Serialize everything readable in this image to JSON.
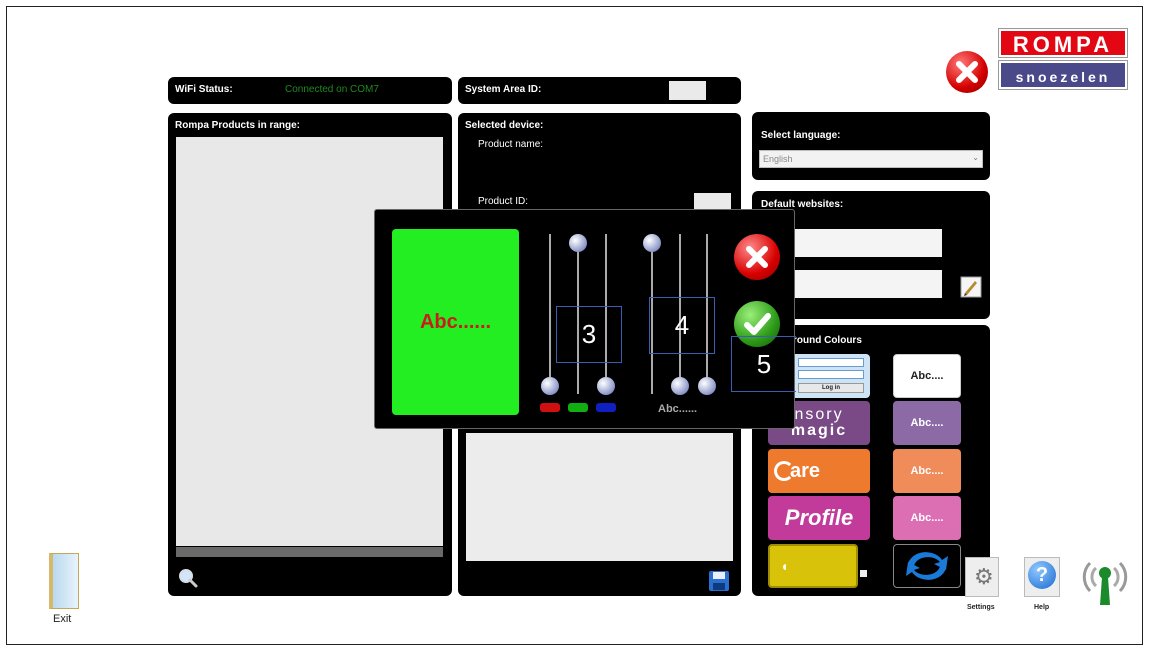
{
  "brand": {
    "top": "ROMPA",
    "bottom": "snoezelen"
  },
  "status": {
    "wifi_label": "WiFi Status:",
    "wifi_value": "Connected on COM7",
    "area_label": "System Area ID:"
  },
  "products": {
    "title": "Rompa Products in range:"
  },
  "device": {
    "title": "Selected device:",
    "name_label": "Product name:",
    "id_label": "Product ID:"
  },
  "language": {
    "title": "Select language:",
    "selected": "English"
  },
  "websites": {
    "title": "Default websites:"
  },
  "background": {
    "title": "round Colours",
    "login_button": "Log in",
    "sensory_line1": "nsory",
    "sensory_line2": "magic",
    "care_text": "are",
    "profile_text": "Profile",
    "abc1": "Abc....",
    "abc2": "Abc....",
    "abc3": "Abc....",
    "abc4": "Abc...."
  },
  "dialog": {
    "preview_text": "Abc......",
    "text_label": "Abc......",
    "box3": "3",
    "box4": "4",
    "box5": "5"
  },
  "bottom": {
    "exit": "Exit",
    "settings": "Settings",
    "help": "Help"
  },
  "colors": {
    "wifi_ok": "#1f8a1f",
    "preview_bg": "#22ee22",
    "preview_text": "#cc1a1a",
    "red": "#d01010",
    "green": "#10b010",
    "blue": "#1020c0"
  }
}
